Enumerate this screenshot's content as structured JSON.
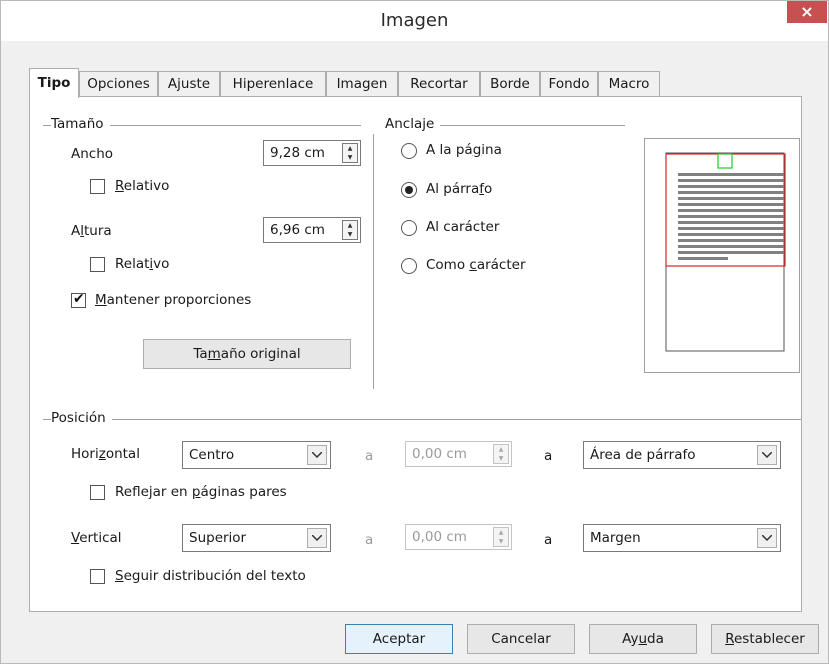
{
  "window": {
    "title": "Imagen",
    "close_icon": "×"
  },
  "tabs": [
    {
      "label": "Tipo",
      "active": true
    },
    {
      "label": "Opciones",
      "active": false
    },
    {
      "label": "Ajuste",
      "active": false
    },
    {
      "label": "Hiperenlace",
      "active": false
    },
    {
      "label": "Imagen",
      "active": false
    },
    {
      "label": "Recortar",
      "active": false
    },
    {
      "label": "Borde",
      "active": false
    },
    {
      "label": "Fondo",
      "active": false
    },
    {
      "label": "Macro",
      "active": false
    }
  ],
  "size": {
    "section_label": "Tamaño",
    "width_label_pre": "Ancho",
    "width_value": "9,28 cm",
    "relative_width_pre": "",
    "relative_width_underlined": "R",
    "relative_width_post": "elativo",
    "relative_width_checked": false,
    "height_label_pre": "A",
    "height_label_underlined": "l",
    "height_label_post": "tura",
    "height_value": "6,96 cm",
    "relative_height_pre": "Relat",
    "relative_height_underlined": "i",
    "relative_height_post": "vo",
    "relative_height_checked": false,
    "keep_ratio_underlined": "M",
    "keep_ratio_post": "antener proporciones",
    "keep_ratio_checked": true,
    "original_size_pre": "Ta",
    "original_size_underlined": "m",
    "original_size_post": "año original"
  },
  "anchor": {
    "section_label": "Anclaje",
    "options": [
      {
        "pre": "A la pá",
        "u": "g",
        "post": "ina",
        "selected": false
      },
      {
        "pre": "Al párra",
        "u": "f",
        "post": "o",
        "selected": true
      },
      {
        "pre": "Al carácter",
        "u": "",
        "post": "",
        "selected": false
      },
      {
        "pre": "Como ",
        "u": "c",
        "post": "arácter",
        "selected": false
      }
    ]
  },
  "position": {
    "section_label": "Posición",
    "horizontal_label_pre": "Hori",
    "horizontal_label_underlined": "z",
    "horizontal_label_post": "ontal",
    "horizontal_value": "Centro",
    "horizontal_by_label": "a",
    "horizontal_offset": "0,00 cm",
    "horizontal_to_label": "a",
    "horizontal_to_value": "Área de párrafo",
    "mirror_pre": "Reflejar en ",
    "mirror_underlined": "p",
    "mirror_post": "áginas pares",
    "mirror_checked": false,
    "vertical_label_underlined": "V",
    "vertical_label_post": "ertical",
    "vertical_value": "Superior",
    "vertical_by_label": "a",
    "vertical_offset": "0,00 cm",
    "vertical_to_label": "a",
    "vertical_to_value": "Margen",
    "follow_underlined": "S",
    "follow_post": "eguir distribución del texto",
    "follow_checked": false
  },
  "buttons": {
    "ok": "Aceptar",
    "cancel": "Cancelar",
    "help_pre": "Ay",
    "help_underlined": "u",
    "help_post": "da",
    "reset_underlined": "R",
    "reset_post": "establecer"
  },
  "colors": {
    "close_button": "#c75050",
    "frame_red": "#e0202c",
    "anchor_green": "#22cc22",
    "default_button_border": "#3c7fb1"
  }
}
